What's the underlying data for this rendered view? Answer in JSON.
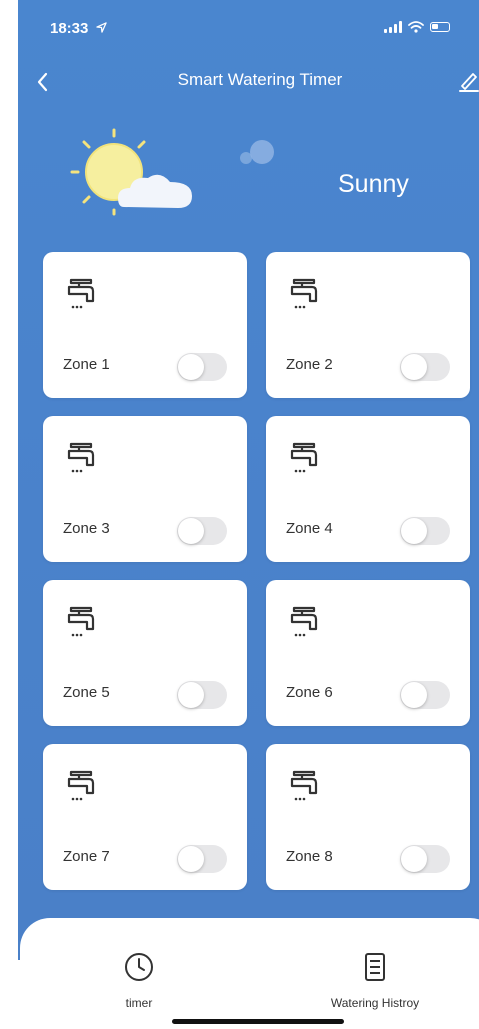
{
  "status_bar": {
    "time": "18:33",
    "location_icon": "location-arrow-icon",
    "icons": [
      "signal-icon",
      "wifi-icon",
      "battery-icon"
    ]
  },
  "nav": {
    "title": "Smart Watering Timer",
    "back_icon": "chevron-left-icon",
    "edit_icon": "edit-pencil-icon"
  },
  "weather": {
    "condition": "Sunny",
    "icon": "sun-cloud-icon"
  },
  "zones": [
    {
      "label": "Zone 1",
      "on": false,
      "icon": "faucet-icon"
    },
    {
      "label": "Zone 2",
      "on": false,
      "icon": "faucet-icon"
    },
    {
      "label": "Zone 3",
      "on": false,
      "icon": "faucet-icon"
    },
    {
      "label": "Zone 4",
      "on": false,
      "icon": "faucet-icon"
    },
    {
      "label": "Zone 5",
      "on": false,
      "icon": "faucet-icon"
    },
    {
      "label": "Zone 6",
      "on": false,
      "icon": "faucet-icon"
    },
    {
      "label": "Zone 7",
      "on": false,
      "icon": "faucet-icon"
    },
    {
      "label": "Zone 8",
      "on": false,
      "icon": "faucet-icon"
    }
  ],
  "tabs": [
    {
      "label": "timer",
      "icon": "clock-icon"
    },
    {
      "label": "Watering Histroy",
      "icon": "document-list-icon"
    }
  ],
  "colors": {
    "background": "#4a83cc",
    "card": "#ffffff",
    "toggle_off": "#e7e7e9",
    "text_dark": "#333333"
  }
}
